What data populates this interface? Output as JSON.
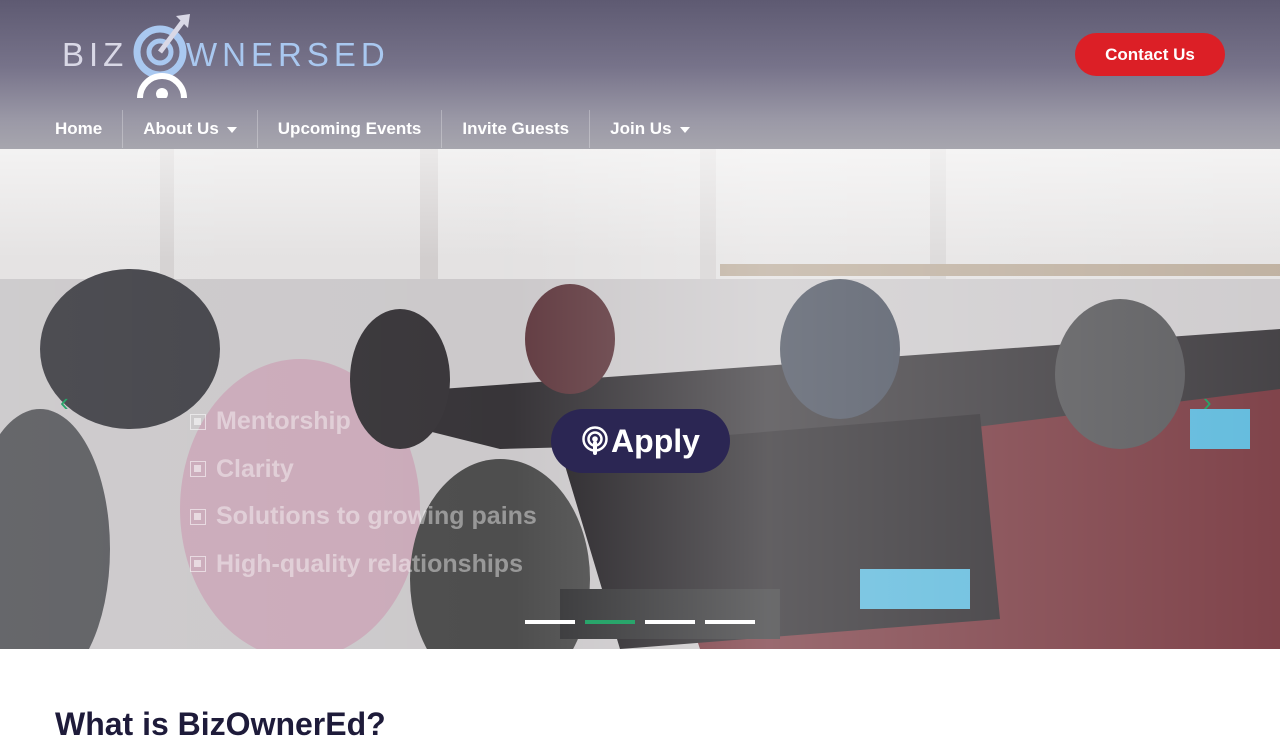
{
  "header": {
    "logo": {
      "left_text": "BIZ",
      "right_text": "WNERSED",
      "icon": "target-arrow-icon"
    },
    "contact_label": "Contact Us",
    "nav": [
      {
        "label": "Home",
        "has_dropdown": false
      },
      {
        "label": "About Us",
        "has_dropdown": true
      },
      {
        "label": "Upcoming Events",
        "has_dropdown": false
      },
      {
        "label": "Invite Guests",
        "has_dropdown": false
      },
      {
        "label": "Join Us",
        "has_dropdown": true
      }
    ]
  },
  "hero": {
    "prev_arrow": "‹",
    "next_arrow": "›",
    "bullets": [
      "Mentorship",
      "Clarity",
      "Solutions to growing pains",
      "High-quality relationships"
    ],
    "apply_label": "Apply",
    "apply_icon": "podcast-icon",
    "slides_total": 4,
    "active_slide": 2
  },
  "section": {
    "title": "What is BizOwnerEd?"
  },
  "colors": {
    "accent_red": "#dc1f26",
    "accent_green": "#29a56b",
    "navy": "#2b2653"
  }
}
